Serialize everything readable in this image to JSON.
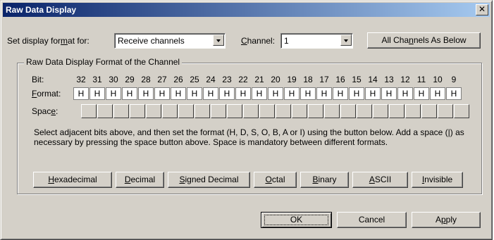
{
  "dialog": {
    "title": "Raw Data Display"
  },
  "top": {
    "format_label": {
      "pre": "Set display for",
      "key": "m",
      "post": "at for:"
    },
    "format_value": "Receive channels",
    "channel_label": {
      "pre": "",
      "key": "C",
      "post": "hannel:"
    },
    "channel_value": "1",
    "all_channels_button": {
      "pre": "All Cha",
      "key": "n",
      "post": "nels As Below"
    }
  },
  "group": {
    "title": "Raw Data Display Format of the Channel",
    "bit_label": "Bit:",
    "format_row_label": {
      "pre": "",
      "key": "F",
      "post": "ormat:"
    },
    "space_row_label": {
      "pre": "Spac",
      "key": "e",
      "post": ":"
    },
    "bits": [
      "32",
      "31",
      "30",
      "29",
      "28",
      "27",
      "26",
      "25",
      "24",
      "23",
      "22",
      "21",
      "20",
      "19",
      "18",
      "17",
      "16",
      "15",
      "14",
      "13",
      "12",
      "11",
      "10",
      "9"
    ],
    "formats": [
      "H",
      "H",
      "H",
      "H",
      "H",
      "H",
      "H",
      "H",
      "H",
      "H",
      "H",
      "H",
      "H",
      "H",
      "H",
      "H",
      "H",
      "H",
      "H",
      "H",
      "H",
      "H",
      "H",
      "H"
    ],
    "instructions": "Select adjacent bits above, and then set the format (H, D, S, O, B, A or I) using the button below.  Add a space (|) as necessary by pressing the space button above.  Space is mandatory between different formats."
  },
  "format_buttons": [
    {
      "key": "H",
      "post": "exadecimal"
    },
    {
      "key": "D",
      "post": "ecimal"
    },
    {
      "key": "S",
      "post": "igned Decimal"
    },
    {
      "key": "O",
      "post": "ctal"
    },
    {
      "key": "B",
      "post": "inary"
    },
    {
      "key": "A",
      "post": "SCII"
    },
    {
      "key": "I",
      "post": "nvisible"
    }
  ],
  "footer": {
    "ok": "OK",
    "cancel": "Cancel",
    "apply": {
      "pre": "A",
      "key": "p",
      "post": "ply"
    }
  }
}
